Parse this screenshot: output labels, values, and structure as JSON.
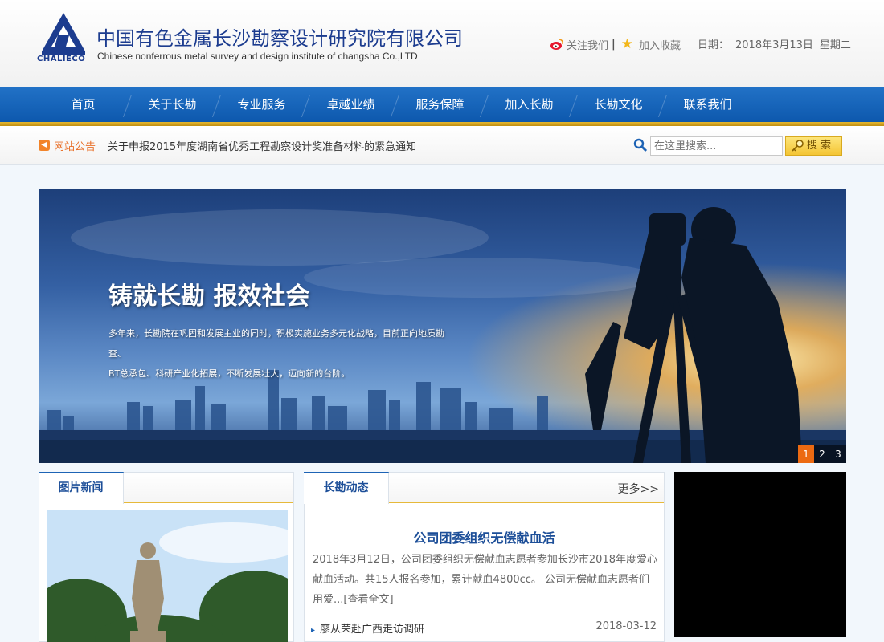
{
  "header": {
    "logo_text": "CHALIECO",
    "company_cn": "中国有色金属长沙勘察设计研究院有限公司",
    "company_en": "Chinese nonferrous metal survey and design institute of changsha Co.,LTD",
    "follow_label": "关注我们",
    "favorite_label": "加入收藏",
    "date_label": "日期：",
    "date_value": "2018年3月13日",
    "weekday": "星期二"
  },
  "nav": {
    "items": [
      "首页",
      "关于长勘",
      "专业服务",
      "卓越业绩",
      "服务保障",
      "加入长勘",
      "长勘文化",
      "联系我们"
    ]
  },
  "notice": {
    "label": "网站公告",
    "text": "关于申报2015年度湖南省优秀工程勘察设计奖准备材料的紧急通知"
  },
  "search": {
    "placeholder": "在这里搜索...",
    "button_label": "搜 索"
  },
  "banner": {
    "title": "铸就长勘 报效社会",
    "desc_line1": "多年来，长勘院在巩固和发展主业的同时，积极实施业务多元化战略，目前正向地质勘查、",
    "desc_line2": "BT总承包、科研产业化拓展，不断发展壮大，迈向新的台阶。",
    "slides": [
      "1",
      "2",
      "3"
    ],
    "active_slide": 1
  },
  "photo_news": {
    "tab_label": "图片新闻"
  },
  "dynamics": {
    "tab_label": "长勘动态",
    "more_label": "更多>>",
    "headline": "公司团委组织无偿献血活",
    "summary": "2018年3月12日，公司团委组织无偿献血志愿者参加长沙市2018年度爱心献血活动。共15人报名参加，累计献血4800cc。 公司无偿献血志愿者们用爱...[查看全文]",
    "items": [
      {
        "title": "廖从荣赴广西走访调研",
        "date": "2018-03-12"
      }
    ]
  },
  "colors": {
    "nav_blue": "#0d58ad",
    "accent_gold": "#e6b93a",
    "notice_orange": "#e8702a",
    "title_blue": "#1c4e98"
  },
  "icons": {
    "weibo": "weibo-icon",
    "star": "star-icon",
    "search": "search-icon",
    "notice": "notice-icon",
    "key": "key-icon"
  }
}
